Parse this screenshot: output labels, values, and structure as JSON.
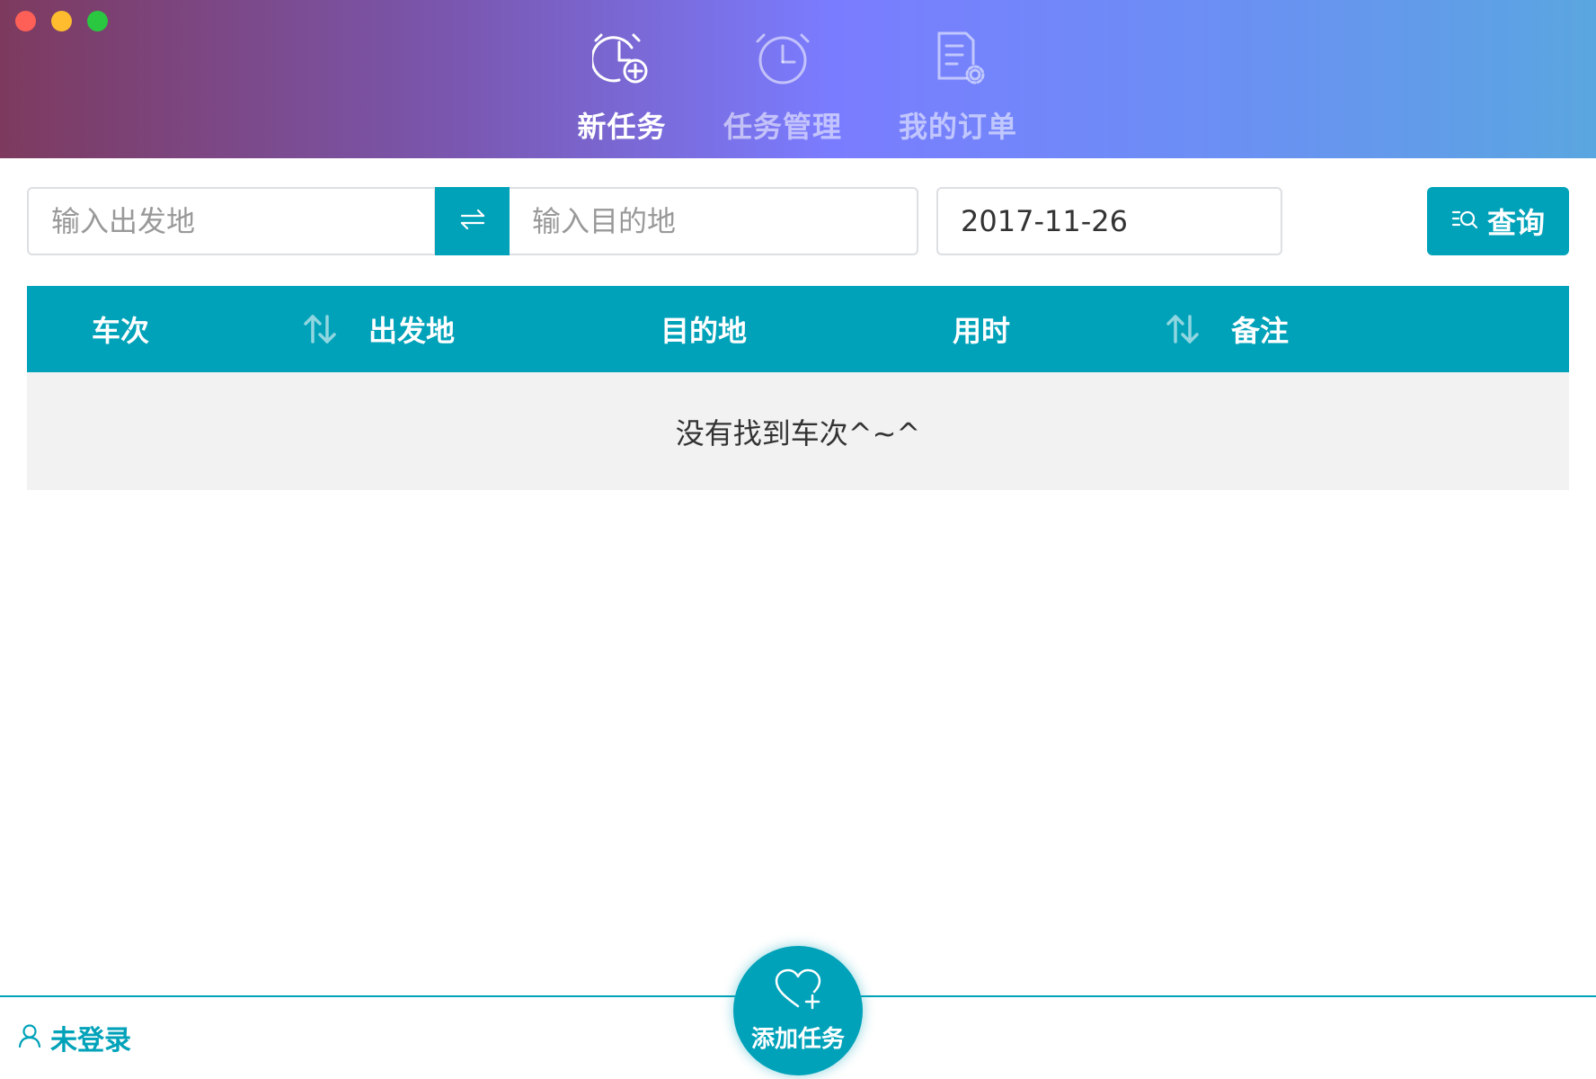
{
  "window": {
    "traffic_lights": [
      "close",
      "minimize",
      "zoom"
    ]
  },
  "nav": {
    "tabs": [
      {
        "label": "新任务",
        "icon": "alarm-clock-plus-icon",
        "active": true
      },
      {
        "label": "任务管理",
        "icon": "alarm-clock-icon",
        "active": false
      },
      {
        "label": "我的订单",
        "icon": "document-gear-icon",
        "active": false
      }
    ]
  },
  "search": {
    "from_placeholder": "输入出发地",
    "to_placeholder": "输入目的地",
    "swap_icon": "swap-arrows-icon",
    "date_value": "2017-11-26",
    "query_label": "查询",
    "query_icon": "search-list-icon"
  },
  "table": {
    "columns": [
      {
        "label": "车次",
        "sortable": true
      },
      {
        "label": "出发地",
        "sortable": false
      },
      {
        "label": "目的地",
        "sortable": false
      },
      {
        "label": "用时",
        "sortable": true
      },
      {
        "label": "备注",
        "sortable": false
      }
    ],
    "rows": [],
    "empty_text": "没有找到车次^~^"
  },
  "footer": {
    "login_label": "未登录",
    "login_icon": "user-icon",
    "add_task_label": "添加任务",
    "add_task_icon": "heart-plus-icon"
  },
  "colors": {
    "accent": "#00a2b9",
    "header_gradient": [
      "#7d3a5e",
      "#7a56ae",
      "#7a7cff",
      "#6c8ef5",
      "#5aa6e0"
    ],
    "empty_row_bg": "#f2f2f2"
  }
}
